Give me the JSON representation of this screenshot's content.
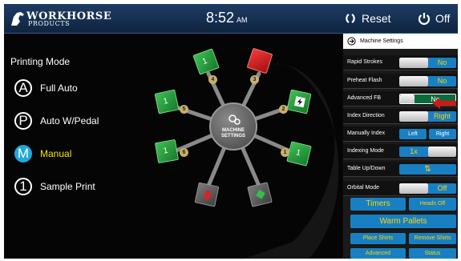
{
  "header": {
    "logo_line1": "WORKHORSE",
    "logo_line2": "PRODUCTS",
    "time": "8:52",
    "ampm": "AM",
    "reset_label": "Reset",
    "off_label": "Off"
  },
  "printing_mode": {
    "title": "Printing Mode",
    "modes": [
      {
        "letter": "A",
        "label": "Full Auto"
      },
      {
        "letter": "P",
        "label": "Auto W/Pedal"
      },
      {
        "letter": "M",
        "label": "Manual"
      },
      {
        "letter": "1",
        "label": "Sample Print"
      }
    ],
    "selected": "Manual"
  },
  "machine": {
    "hub_line1": "MACHINE",
    "hub_line2": "SETTINGS",
    "stations": [
      {
        "badge": "1",
        "pallet": "1",
        "color": "green"
      },
      {
        "badge": "2",
        "pallet": "",
        "color": "green"
      },
      {
        "badge": "3",
        "pallet": "",
        "color": "red"
      },
      {
        "badge": "4",
        "pallet": "1",
        "color": "green"
      },
      {
        "badge": "5",
        "pallet": "1",
        "color": "green"
      },
      {
        "badge": "6",
        "pallet": "1",
        "color": "green"
      },
      {
        "badge": "1",
        "pallet": "1",
        "color": "green"
      }
    ]
  },
  "settings": {
    "title": "Machine Settings",
    "rows": [
      {
        "label": "Rapid Strokes",
        "value": "No"
      },
      {
        "label": "Preheat Flash",
        "value": "No"
      },
      {
        "label": "Advanced FB",
        "value": "No"
      },
      {
        "label": "Index Direction",
        "value": "Right"
      },
      {
        "label": "Manually Index",
        "left": "Left",
        "right": "Right"
      },
      {
        "label": "Indexing Mode",
        "value": "1x"
      },
      {
        "label": "Table Up/Down",
        "value": "⇅"
      },
      {
        "label": "Orbital Mode",
        "value": "Off"
      }
    ],
    "buttons": {
      "timers": "Timers",
      "heads_off": "Heads Off",
      "warm_pallets": "Warm Pallets",
      "place_shirts": "Place Shirts",
      "remove_shirts": "Remove Shirts",
      "advanced": "Advanced",
      "status": "Status"
    }
  }
}
